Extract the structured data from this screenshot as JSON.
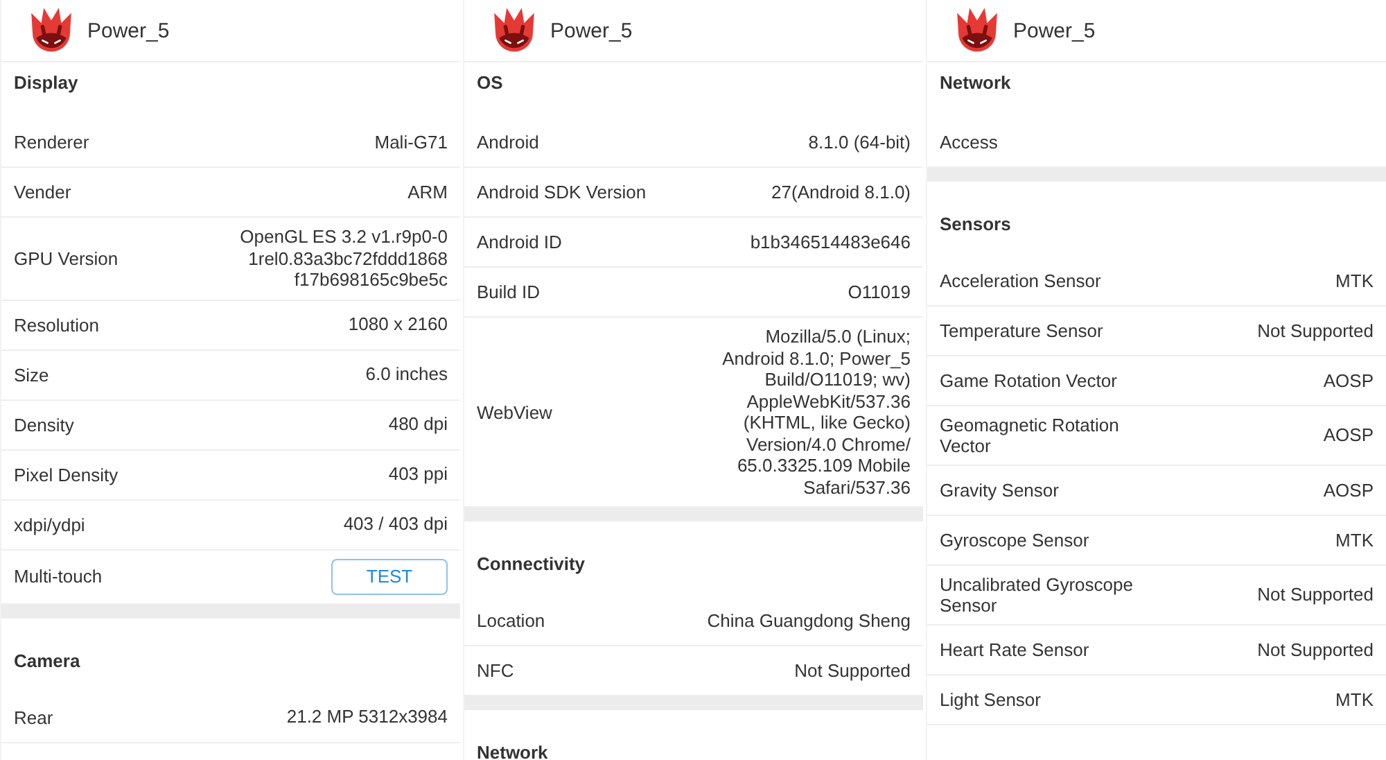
{
  "panels": [
    {
      "title": "Power_5",
      "sections": [
        {
          "heading": "Display",
          "rows": [
            {
              "kind": "text",
              "label": "Renderer",
              "value": "Mali-G71"
            },
            {
              "kind": "text",
              "label": "Vender",
              "value": "ARM"
            },
            {
              "kind": "text",
              "label": "GPU Version",
              "value": "OpenGL ES 3.2 v1.r9p0-0\n1rel0.83a3bc72fddd1868\nf17b698165c9be5c"
            },
            {
              "kind": "text",
              "label": "Resolution",
              "value": "1080 x 2160"
            },
            {
              "kind": "text",
              "label": "Size",
              "value": "6.0 inches"
            },
            {
              "kind": "text",
              "label": "Density",
              "value": "480 dpi"
            },
            {
              "kind": "text",
              "label": "Pixel Density",
              "value": "403 ppi"
            },
            {
              "kind": "text",
              "label": "xdpi/ydpi",
              "value": "403 / 403 dpi"
            },
            {
              "kind": "button",
              "label": "Multi-touch",
              "value": "TEST"
            }
          ]
        },
        {
          "heading": "Camera",
          "rows": [
            {
              "kind": "text",
              "label": "Rear",
              "value": "21.2 MP 5312x3984"
            }
          ]
        }
      ]
    },
    {
      "title": "Power_5",
      "sections": [
        {
          "heading": "OS",
          "rows": [
            {
              "kind": "text",
              "label": "Android",
              "value": "8.1.0 (64-bit)"
            },
            {
              "kind": "text",
              "label": "Android SDK Version",
              "value": "27(Android 8.1.0)"
            },
            {
              "kind": "text",
              "label": "Android ID",
              "value": "b1b346514483e646"
            },
            {
              "kind": "text",
              "label": "Build ID",
              "value": "O11019"
            },
            {
              "kind": "text",
              "label": "WebView",
              "value": "Mozilla/5.0 (Linux;\nAndroid 8.1.0; Power_5\nBuild/O11019; wv)\nAppleWebKit/537.36\n(KHTML, like Gecko)\nVersion/4.0 Chrome/\n65.0.3325.109 Mobile\nSafari/537.36"
            }
          ]
        },
        {
          "heading": "Connectivity",
          "rows": [
            {
              "kind": "text",
              "label": "Location",
              "value": "China Guangdong Sheng"
            },
            {
              "kind": "text",
              "label": "NFC",
              "value": "Not Supported"
            }
          ]
        },
        {
          "heading": "Network"
        }
      ]
    },
    {
      "title": "Power_5",
      "sections": [
        {
          "heading": "Network",
          "rows": [
            {
              "label": "Access"
            }
          ]
        },
        {
          "heading": "Sensors",
          "rows": [
            {
              "kind": "text",
              "label": "Acceleration Sensor",
              "value": "MTK"
            },
            {
              "kind": "text",
              "label": "Temperature Sensor",
              "value": "Not Supported"
            },
            {
              "kind": "text",
              "label": "Game Rotation Vector",
              "value": "AOSP"
            },
            {
              "kind": "text",
              "label": "Geomagnetic Rotation\nVector",
              "value": "AOSP"
            },
            {
              "kind": "text",
              "label": "Gravity Sensor",
              "value": "AOSP"
            },
            {
              "kind": "text",
              "label": "Gyroscope Sensor",
              "value": "MTK"
            },
            {
              "kind": "text",
              "label": "Uncalibrated Gyroscope\nSensor",
              "value": "Not Supported"
            },
            {
              "kind": "text",
              "label": "Heart Rate Sensor",
              "value": "Not Supported"
            },
            {
              "kind": "text",
              "label": "Light Sensor",
              "value": "MTK"
            }
          ]
        }
      ]
    }
  ]
}
